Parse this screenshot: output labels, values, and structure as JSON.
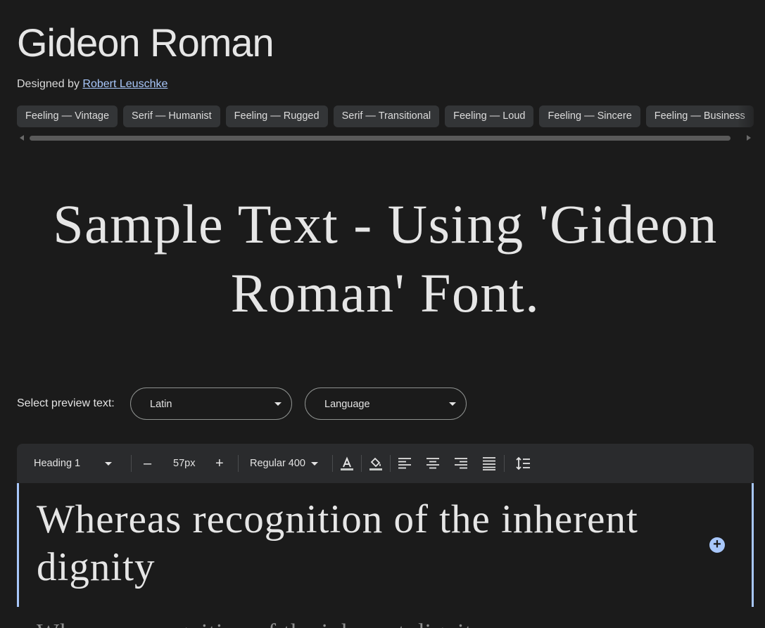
{
  "header": {
    "font_name": "Gideon Roman",
    "designed_by_prefix": "Designed by",
    "designer": "Robert Leuschke"
  },
  "tags": [
    "Feeling — Vintage",
    "Serif — Humanist",
    "Feeling — Rugged",
    "Serif — Transitional",
    "Feeling — Loud",
    "Feeling — Sincere",
    "Feeling — Business"
  ],
  "sample": {
    "text": "Sample Text - Using 'Gideon Roman' Font."
  },
  "preview": {
    "label": "Select preview text:",
    "script_select": "Latin",
    "language_select": "Language"
  },
  "toolbar": {
    "style": "Heading 1",
    "decrease": "–",
    "size": "57px",
    "increase": "+",
    "weight": "Regular 400",
    "icons": [
      "text-color-icon",
      "highlight-color-icon",
      "align-left-icon",
      "align-center-icon",
      "align-right-icon",
      "align-justify-icon",
      "line-height-icon"
    ]
  },
  "editor": {
    "text": "Whereas recognition of the inherent dignity",
    "next_line": "Whereas recognition of the inherent dignity"
  },
  "colors": {
    "background": "#1b1b1b",
    "accent": "#a8c7fa",
    "chip": "#333537"
  }
}
